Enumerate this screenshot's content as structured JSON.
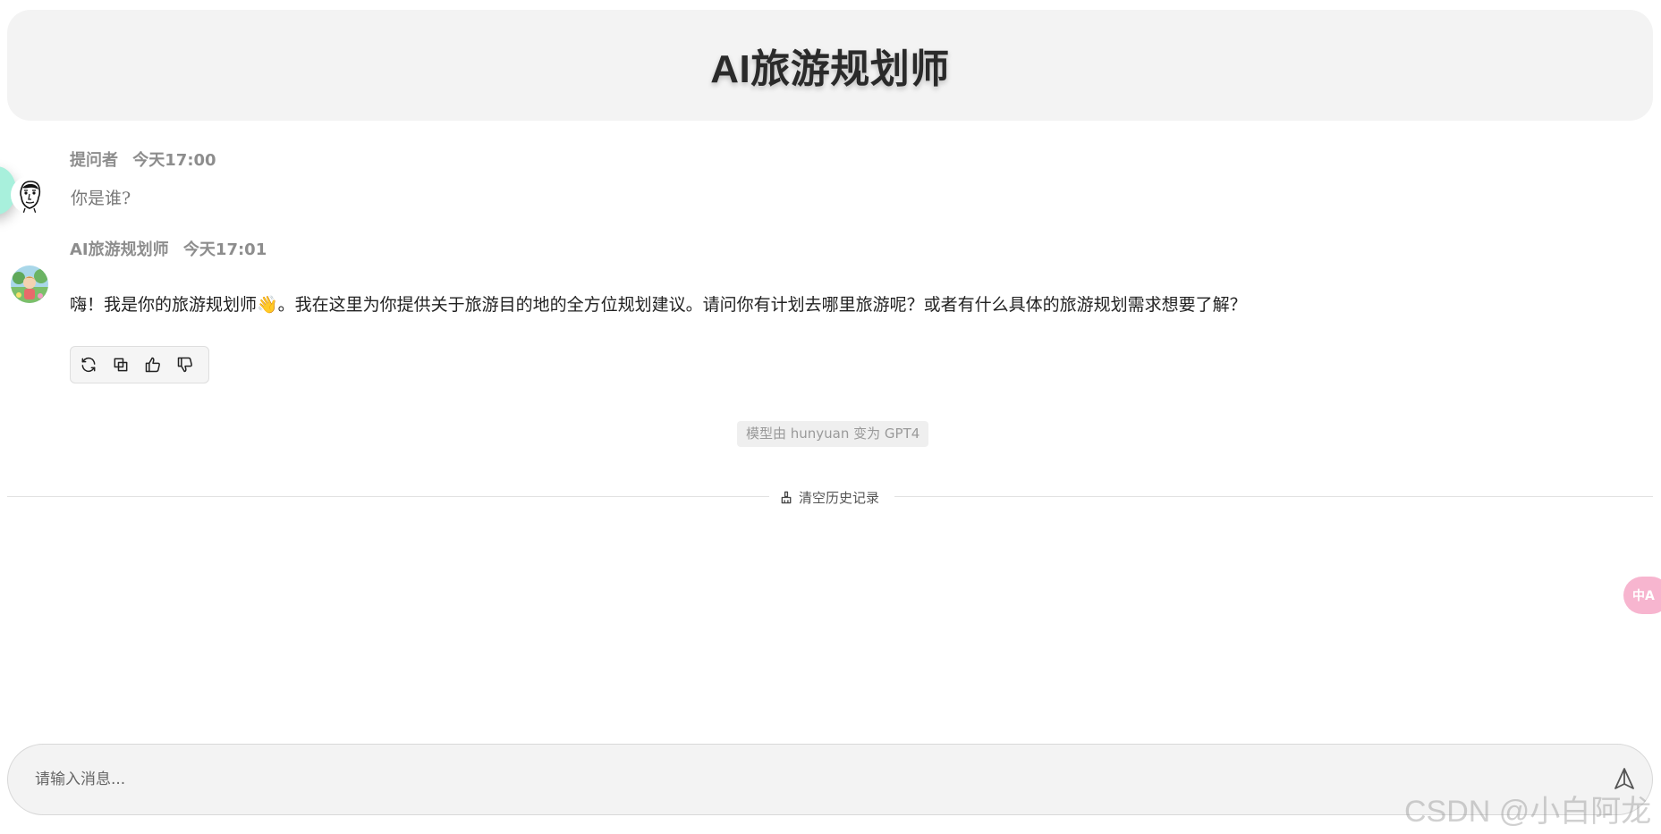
{
  "header": {
    "title": "AI旅游规划师"
  },
  "messages": [
    {
      "role": "user",
      "author": "提问者",
      "time": "今天17:00",
      "text": "你是谁?",
      "avatar_icon": "sketch-face-avatar"
    },
    {
      "role": "assistant",
      "author": "AI旅游规划师",
      "time": "今天17:01",
      "text": "嗨！我是你的旅游规划师👋。我在这里为你提供关于旅游目的地的全方位规划建议。请问你有计划去哪里旅游呢？或者有什么具体的旅游规划需求想要了解？",
      "avatar_icon": "cartoon-avatar"
    }
  ],
  "actions": {
    "icons": [
      "refresh-icon",
      "copy-icon",
      "thumbs-up-icon",
      "thumbs-down-icon"
    ]
  },
  "model_change": {
    "text": "模型由 hunyuan 变为 GPT4"
  },
  "clear_history": {
    "label": "清空历史记录",
    "icon": "broom-icon"
  },
  "input": {
    "placeholder": "请输入消息...",
    "value": ""
  },
  "translate_fab": {
    "label": "中A",
    "color": "#f7b5cf"
  },
  "watermark": {
    "text": "CSDN @小白阿龙"
  },
  "colors": {
    "header_bg": "#f3f3f3",
    "side_dot": "#a8f0dc",
    "meta_text": "#8d8d8d"
  }
}
